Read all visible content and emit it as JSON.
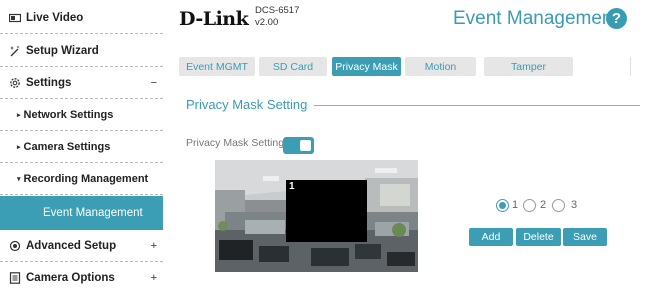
{
  "sidebar": {
    "items": [
      {
        "label": "Live Video",
        "icon": "video-icon"
      },
      {
        "label": "Setup Wizard",
        "icon": "wand-icon"
      },
      {
        "label": "Settings",
        "icon": "gear-icon",
        "toggle": "−"
      },
      {
        "label": "Network Settings",
        "icon": "arrow-right-icon"
      },
      {
        "label": "Camera Settings",
        "icon": "arrow-right-icon"
      },
      {
        "label": "Recording Management",
        "icon": "arrow-down-icon"
      },
      {
        "label": "Event Management",
        "active": true
      },
      {
        "label": "Advanced Setup",
        "icon": "advanced-gear-icon",
        "toggle": "+"
      },
      {
        "label": "Camera Options",
        "icon": "document-icon",
        "toggle": "+"
      }
    ]
  },
  "header": {
    "logo": "D-Link",
    "model": "DCS-6517",
    "version": "v2.00",
    "page_title": "Event Management",
    "help": "?"
  },
  "tabs": [
    {
      "label": "Event MGMT"
    },
    {
      "label": "SD Card"
    },
    {
      "label": "Privacy Mask",
      "active": true
    },
    {
      "label": "Motion"
    },
    {
      "label": "Tamper"
    }
  ],
  "section": {
    "title": "Privacy Mask Setting",
    "setting_label": "Privacy Mask Setting",
    "toggle_on": true
  },
  "preview": {
    "mask_number": "1"
  },
  "mask_selector": {
    "options": [
      "1",
      "2",
      "3"
    ],
    "selected": "1"
  },
  "buttons": {
    "add": "Add",
    "delete": "Delete",
    "save": "Save"
  },
  "colors": {
    "accent": "#3b9eb5",
    "tab_bg": "#e6e6e6"
  }
}
